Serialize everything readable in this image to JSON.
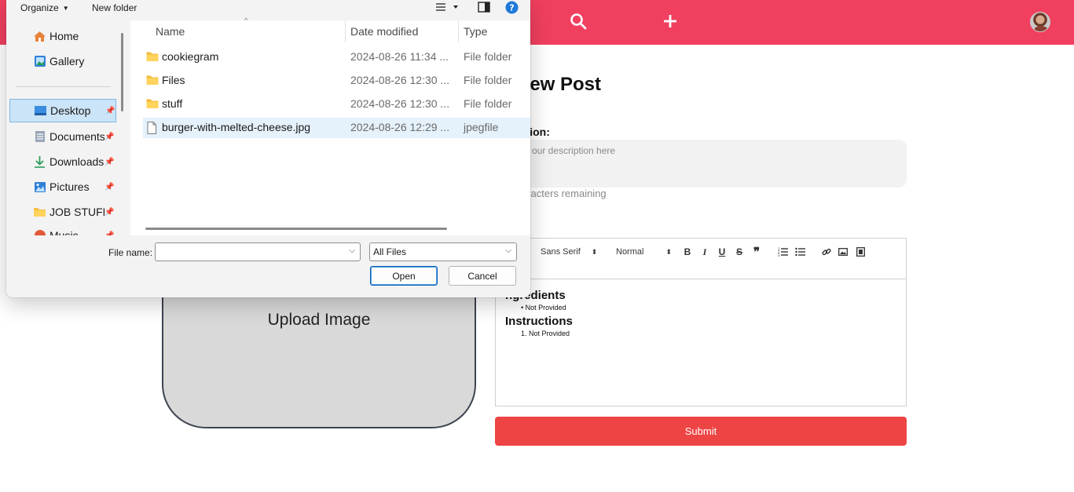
{
  "app": {
    "page_title": "Create New Post",
    "visible_title": "New Post",
    "description": {
      "label": "ption:",
      "placeholder": "our description here",
      "chars_remaining": "aracters remaining"
    },
    "recipe_label": ":",
    "editor": {
      "font_select": "Sans Serif",
      "size_select": "Normal",
      "content": {
        "ingredients_heading": "ngredients",
        "ingredients_item": "Not Provided",
        "instructions_heading": "Instructions",
        "instructions_item": "1. Not Provided"
      }
    },
    "submit_label": "Submit",
    "upload_label": "Upload Image",
    "colors": {
      "topbar": "#f13f5f",
      "submit": "#ef4444"
    }
  },
  "dialog": {
    "toolbar": {
      "organize_label": "Organize",
      "new_folder_label": "New folder"
    },
    "nav": {
      "items": [
        {
          "label": "Home",
          "icon": "home-icon",
          "pinned": false
        },
        {
          "label": "Gallery",
          "icon": "gallery-icon",
          "pinned": false
        },
        {
          "label": "Desktop",
          "icon": "desktop-icon",
          "pinned": true
        },
        {
          "label": "Documents",
          "icon": "documents-icon",
          "pinned": true
        },
        {
          "label": "Downloads",
          "icon": "downloads-icon",
          "pinned": true
        },
        {
          "label": "Pictures",
          "icon": "pictures-icon",
          "pinned": true
        },
        {
          "label": "JOB STUFF",
          "icon": "folder-icon",
          "pinned": true
        },
        {
          "label": "Music",
          "icon": "music-icon",
          "pinned": true
        }
      ]
    },
    "columns": {
      "name": "Name",
      "date": "Date modified",
      "type": "Type"
    },
    "files": [
      {
        "name": "cookiegram",
        "date": "2024-08-26 11:34 ...",
        "type": "File folder",
        "icon": "folder-icon"
      },
      {
        "name": "Files",
        "date": "2024-08-26 12:30 ...",
        "type": "File folder",
        "icon": "folder-icon"
      },
      {
        "name": "stuff",
        "date": "2024-08-26 12:30 ...",
        "type": "File folder",
        "icon": "folder-icon"
      },
      {
        "name": "burger-with-melted-cheese.jpg",
        "date": "2024-08-26 12:29 ...",
        "type": "jpegfile",
        "icon": "file-icon"
      }
    ],
    "file_name_label": "File name:",
    "file_name_value": "",
    "file_type_value": "All Files",
    "open_label": "Open",
    "cancel_label": "Cancel"
  }
}
